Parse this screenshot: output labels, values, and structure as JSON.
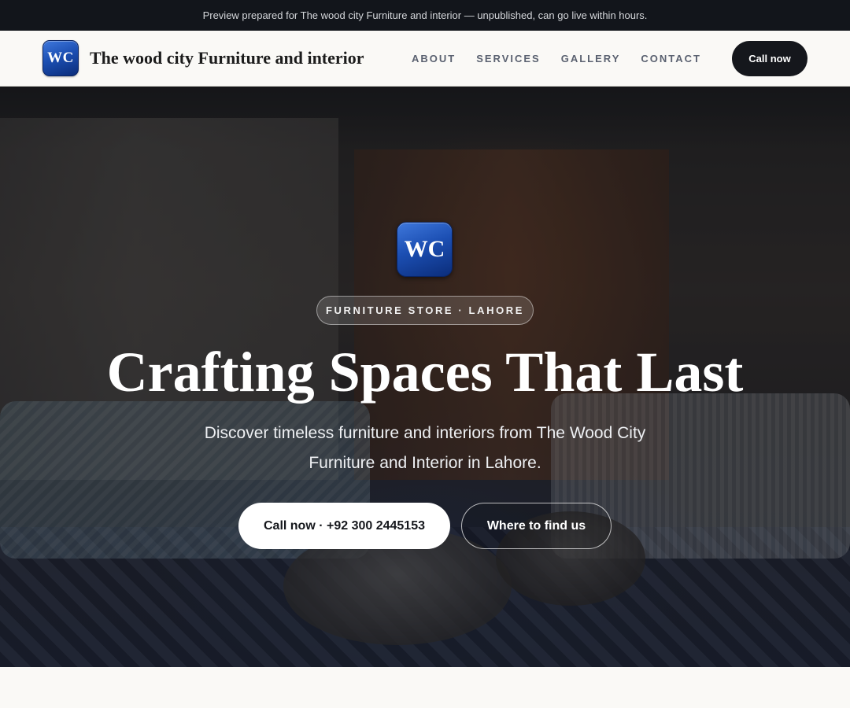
{
  "preview_bar": {
    "text": "Preview prepared for The wood city Furniture and interior — unpublished, can go live within hours."
  },
  "header": {
    "logo_text": "WC",
    "brand_name": "The wood city Furniture and interior",
    "nav": [
      {
        "label": "ABOUT"
      },
      {
        "label": "SERVICES"
      },
      {
        "label": "GALLERY"
      },
      {
        "label": "CONTACT"
      }
    ],
    "cta_label": "Call now"
  },
  "hero": {
    "logo_text": "WC",
    "tag": "FURNITURE STORE · LAHORE",
    "title": "Crafting Spaces That Last",
    "subtitle": "Discover timeless furniture and interiors from The Wood City Furniture and Interior in Lahore.",
    "primary_button": "Call now · +92 300 2445153",
    "secondary_button": "Where to find us"
  },
  "colors": {
    "dark": "#15171c",
    "logo_blue": "#1c4fb3",
    "page_bg": "#faf9f6"
  }
}
